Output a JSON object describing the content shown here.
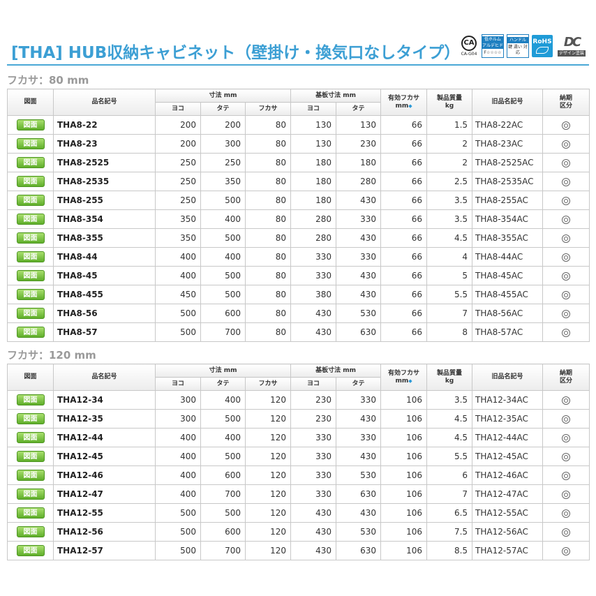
{
  "page_title": "[THA] HUB収納キャビネット（壁掛け・換気口なしタイプ）",
  "certifications": {
    "ca": {
      "label": "CA",
      "sub": "CA-G04",
      "icon": "ca-certification-icon"
    },
    "formaldehyde": {
      "top": "低ホルム アルデヒド",
      "bottom": "F☆☆☆☆",
      "icon": "low-formaldehyde-icon"
    },
    "handle": {
      "top": "ハンドル",
      "bottom": "鍵 違い 対応",
      "icon": "handle-key-icon"
    },
    "rohs": {
      "label": "RoHS",
      "icon": "rohs-leaf-icon"
    },
    "dc": {
      "mark": "DC",
      "label": "デザイン塗装",
      "icon": "design-coating-icon"
    }
  },
  "headers": {
    "diagram": "図面",
    "model": "品名記号",
    "dimensions": "寸法 mm",
    "width": "ヨコ",
    "height": "タテ",
    "depth": "フカサ",
    "board": "基板寸法 mm",
    "board_width": "ヨコ",
    "board_height": "タテ",
    "effective_depth_1": "有効フカサ",
    "effective_depth_2": "mm",
    "weight_1": "製品質量",
    "weight_2": "kg",
    "old_model": "旧品名記号",
    "delivery_1": "納期",
    "delivery_2": "区分"
  },
  "diagram_button_label": "図面",
  "delivery_icon": "double-circle-icon",
  "sections": [
    {
      "title": "フカサ：80 mm",
      "rows": [
        {
          "model": "THA8-22",
          "w": "200",
          "h": "200",
          "d": "80",
          "bw": "130",
          "bh": "130",
          "ed": "66",
          "kg": "1.5",
          "old": "THA8-22AC"
        },
        {
          "model": "THA8-23",
          "w": "200",
          "h": "300",
          "d": "80",
          "bw": "130",
          "bh": "230",
          "ed": "66",
          "kg": "2",
          "old": "THA8-23AC"
        },
        {
          "model": "THA8-2525",
          "w": "250",
          "h": "250",
          "d": "80",
          "bw": "180",
          "bh": "180",
          "ed": "66",
          "kg": "2",
          "old": "THA8-2525AC"
        },
        {
          "model": "THA8-2535",
          "w": "250",
          "h": "350",
          "d": "80",
          "bw": "180",
          "bh": "280",
          "ed": "66",
          "kg": "2.5",
          "old": "THA8-2535AC"
        },
        {
          "model": "THA8-255",
          "w": "250",
          "h": "500",
          "d": "80",
          "bw": "180",
          "bh": "430",
          "ed": "66",
          "kg": "3.5",
          "old": "THA8-255AC"
        },
        {
          "model": "THA8-354",
          "w": "350",
          "h": "400",
          "d": "80",
          "bw": "280",
          "bh": "330",
          "ed": "66",
          "kg": "3.5",
          "old": "THA8-354AC"
        },
        {
          "model": "THA8-355",
          "w": "350",
          "h": "500",
          "d": "80",
          "bw": "280",
          "bh": "430",
          "ed": "66",
          "kg": "4.5",
          "old": "THA8-355AC"
        },
        {
          "model": "THA8-44",
          "w": "400",
          "h": "400",
          "d": "80",
          "bw": "330",
          "bh": "330",
          "ed": "66",
          "kg": "4",
          "old": "THA8-44AC"
        },
        {
          "model": "THA8-45",
          "w": "400",
          "h": "500",
          "d": "80",
          "bw": "330",
          "bh": "430",
          "ed": "66",
          "kg": "5",
          "old": "THA8-45AC"
        },
        {
          "model": "THA8-455",
          "w": "450",
          "h": "500",
          "d": "80",
          "bw": "380",
          "bh": "430",
          "ed": "66",
          "kg": "5.5",
          "old": "THA8-455AC"
        },
        {
          "model": "THA8-56",
          "w": "500",
          "h": "600",
          "d": "80",
          "bw": "430",
          "bh": "530",
          "ed": "66",
          "kg": "7",
          "old": "THA8-56AC"
        },
        {
          "model": "THA8-57",
          "w": "500",
          "h": "700",
          "d": "80",
          "bw": "430",
          "bh": "630",
          "ed": "66",
          "kg": "8",
          "old": "THA8-57AC"
        }
      ]
    },
    {
      "title": "フカサ：120 mm",
      "rows": [
        {
          "model": "THA12-34",
          "w": "300",
          "h": "400",
          "d": "120",
          "bw": "230",
          "bh": "330",
          "ed": "106",
          "kg": "3.5",
          "old": "THA12-34AC"
        },
        {
          "model": "THA12-35",
          "w": "300",
          "h": "500",
          "d": "120",
          "bw": "230",
          "bh": "430",
          "ed": "106",
          "kg": "4.5",
          "old": "THA12-35AC"
        },
        {
          "model": "THA12-44",
          "w": "400",
          "h": "400",
          "d": "120",
          "bw": "330",
          "bh": "330",
          "ed": "106",
          "kg": "4.5",
          "old": "THA12-44AC"
        },
        {
          "model": "THA12-45",
          "w": "400",
          "h": "500",
          "d": "120",
          "bw": "330",
          "bh": "430",
          "ed": "106",
          "kg": "5.5",
          "old": "THA12-45AC"
        },
        {
          "model": "THA12-46",
          "w": "400",
          "h": "600",
          "d": "120",
          "bw": "330",
          "bh": "530",
          "ed": "106",
          "kg": "6",
          "old": "THA12-46AC"
        },
        {
          "model": "THA12-47",
          "w": "400",
          "h": "700",
          "d": "120",
          "bw": "330",
          "bh": "630",
          "ed": "106",
          "kg": "7",
          "old": "THA12-47AC"
        },
        {
          "model": "THA12-55",
          "w": "500",
          "h": "500",
          "d": "120",
          "bw": "430",
          "bh": "430",
          "ed": "106",
          "kg": "6.5",
          "old": "THA12-55AC"
        },
        {
          "model": "THA12-56",
          "w": "500",
          "h": "600",
          "d": "120",
          "bw": "430",
          "bh": "530",
          "ed": "106",
          "kg": "7.5",
          "old": "THA12-56AC"
        },
        {
          "model": "THA12-57",
          "w": "500",
          "h": "700",
          "d": "120",
          "bw": "430",
          "bh": "630",
          "ed": "106",
          "kg": "8.5",
          "old": "THA12-57AC"
        }
      ]
    }
  ]
}
